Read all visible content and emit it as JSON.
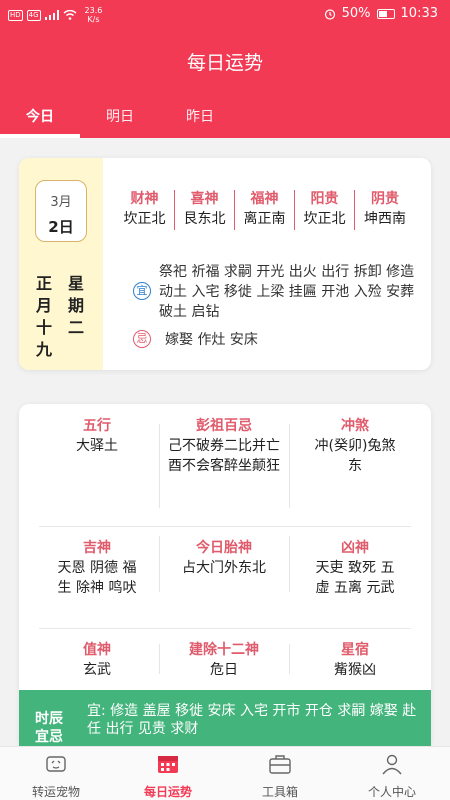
{
  "status_bar": {
    "hd": "HD",
    "network": "4G",
    "speed_value": "23.6",
    "speed_unit": "K/s",
    "battery": "50%",
    "time": "10:33"
  },
  "header": {
    "title": "每日运势",
    "tabs": [
      {
        "label": "今日",
        "active": true
      },
      {
        "label": "明日",
        "active": false
      },
      {
        "label": "昨日",
        "active": false
      }
    ]
  },
  "date_card": {
    "month": "3月",
    "day": "2日",
    "lunar_left": [
      "正",
      "月",
      "十",
      "九"
    ],
    "lunar_right": [
      "星",
      "期",
      "二"
    ],
    "gods": [
      {
        "name": "财神",
        "value": "坎正北"
      },
      {
        "name": "喜神",
        "value": "艮东北"
      },
      {
        "name": "福神",
        "value": "离正南"
      },
      {
        "name": "阳贵",
        "value": "坎正北"
      },
      {
        "name": "阴贵",
        "value": "坤西南"
      }
    ],
    "yi_label": "宜",
    "yi_text": "祭祀 祈福 求嗣 开光 出火 出行 拆卸 修造 动土 入宅 移徙 上梁 挂匾 开池 入殓 安葬 破土 启钻",
    "ji_label": "忌",
    "ji_text": "嫁娶 作灶 安床"
  },
  "detail_card": {
    "wuxing": {
      "title": "五行",
      "value": "大驿土"
    },
    "pengzu": {
      "title": "彭祖百忌",
      "value": "己不破券二比并亡 酉不会客醉坐颠狂"
    },
    "chongsha": {
      "title": "冲煞",
      "value": "冲(癸卯)兔煞东"
    },
    "jishen": {
      "title": "吉神",
      "value": "天恩 阴德 福生 除神 鸣吠"
    },
    "taishen": {
      "title": "今日胎神",
      "value": "占大门外东北"
    },
    "xiongshen": {
      "title": "凶神",
      "value": "天吏 致死 五虚 五离 元武"
    },
    "zhishen": {
      "title": "值神",
      "value": "玄武"
    },
    "jianchu": {
      "title": "建除十二神",
      "value": "危日"
    },
    "xingxiu": {
      "title": "星宿",
      "value": "觜猴凶"
    }
  },
  "shichen": {
    "label": "时辰宜忌",
    "text": "宜:  修造 盖屋 移徙 安床 入宅 开市 开仓 求嗣 嫁娶 赴任 出行 见贵 求财"
  },
  "bottom_nav": [
    {
      "label": "转运宠物",
      "icon": "pet-icon",
      "active": false
    },
    {
      "label": "每日运势",
      "icon": "calendar-icon",
      "active": true
    },
    {
      "label": "工具箱",
      "icon": "toolbox-icon",
      "active": false
    },
    {
      "label": "个人中心",
      "icon": "user-icon",
      "active": false
    }
  ],
  "colors": {
    "primary": "#f23a55",
    "accent_text": "#e05b6c",
    "green": "#43b47c",
    "date_bg": "#fff7cf"
  }
}
